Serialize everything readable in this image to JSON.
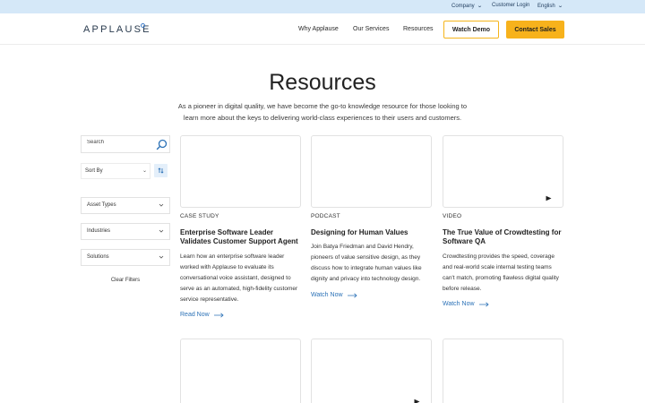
{
  "utility": {
    "company": "Company",
    "login": "Customer Login",
    "language": "English"
  },
  "header": {
    "logo": "APPLAUSE",
    "nav": [
      "Why Applause",
      "Our Services",
      "Resources"
    ],
    "watch_demo": "Watch Demo",
    "contact_sales": "Contact Sales"
  },
  "hero": {
    "title": "Resources",
    "intro_line1": "As a pioneer in digital quality, we have become the go-to knowledge resource for those looking to",
    "intro_line2": "learn more about the keys to delivering world-class experiences to their users and customers."
  },
  "sidebar": {
    "search_placeholder": "Search",
    "sort_label": "Sort By",
    "filters": [
      "Asset Types",
      "Industries",
      "Solutions"
    ],
    "clear": "Clear Filters"
  },
  "cards": [
    {
      "category": "CASE STUDY",
      "title": "Enterprise Software Leader Validates Customer Support Agent",
      "desc": "Learn how an enterprise software leader worked with Applause to evaluate its conversational voice assistant, designed to serve as an automated, high-fidelity customer service representative.",
      "link": "Read Now"
    },
    {
      "category": "PODCAST",
      "title": "Designing for Human Values",
      "desc": "Join Batya Friedman and David Hendry, pioneers of value sensitive design, as they discuss how to integrate human values like dignity and privacy into technology design.",
      "link": "Watch Now"
    },
    {
      "category": "VIDEO",
      "title": "The True Value of Crowdtesting for Software QA",
      "desc": "Crowdtesting provides the speed, coverage and real-world scale internal testing teams can't match, promoting flawless digital quality before release.",
      "link": "Watch Now"
    }
  ],
  "colors": {
    "accent": "#f7b21c",
    "link": "#2c72b7",
    "utility_bg": "#d5e8f8"
  }
}
